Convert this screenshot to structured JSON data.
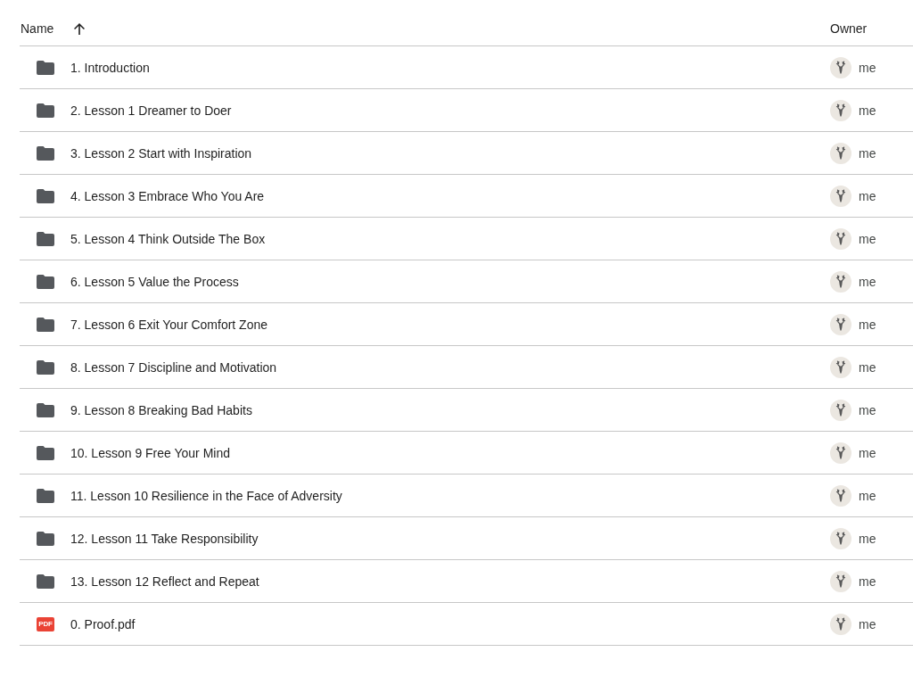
{
  "columns": [
    {
      "label": "Name",
      "sorted": true
    },
    {
      "label": "Owner",
      "sorted": false
    }
  ],
  "rows": [
    {
      "kind": "folder",
      "name": "1. Introduction",
      "owner": "me"
    },
    {
      "kind": "folder",
      "name": "2. Lesson 1 Dreamer to Doer",
      "owner": "me"
    },
    {
      "kind": "folder",
      "name": "3. Lesson 2 Start with Inspiration",
      "owner": "me"
    },
    {
      "kind": "folder",
      "name": "4. Lesson 3 Embrace Who You Are",
      "owner": "me"
    },
    {
      "kind": "folder",
      "name": "5. Lesson 4 Think Outside The Box",
      "owner": "me"
    },
    {
      "kind": "folder",
      "name": "6. Lesson 5 Value the Process",
      "owner": "me"
    },
    {
      "kind": "folder",
      "name": "7. Lesson 6 Exit Your Comfort Zone",
      "owner": "me"
    },
    {
      "kind": "folder",
      "name": "8. Lesson 7 Discipline and Motivation",
      "owner": "me"
    },
    {
      "kind": "folder",
      "name": "9. Lesson 8 Breaking Bad Habits",
      "owner": "me"
    },
    {
      "kind": "folder",
      "name": "10. Lesson 9 Free Your Mind",
      "owner": "me"
    },
    {
      "kind": "folder",
      "name": "11. Lesson 10 Resilience in the Face of Adversity",
      "owner": "me"
    },
    {
      "kind": "folder",
      "name": "12. Lesson 11 Take Responsibility",
      "owner": "me"
    },
    {
      "kind": "folder",
      "name": "13. Lesson 12 Reflect and Repeat",
      "owner": "me"
    },
    {
      "kind": "pdf",
      "icon_label": "PDF",
      "name": "0. Proof.pdf",
      "owner": "me"
    }
  ]
}
